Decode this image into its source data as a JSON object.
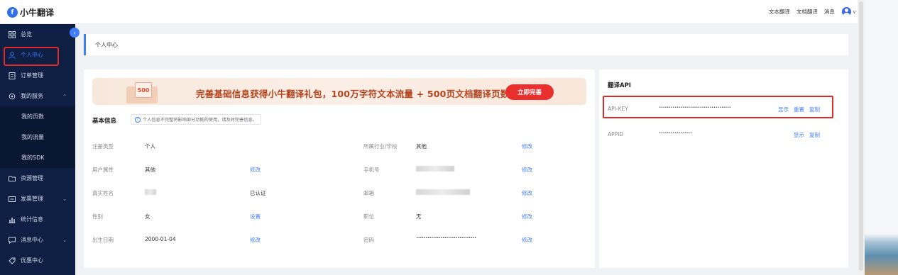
{
  "app": {
    "name": "小牛翻译",
    "logo_glyph": "f"
  },
  "topbar": {
    "links": [
      "文本翻译",
      "文档翻译",
      "消息"
    ],
    "dropdown_glyph": "∨"
  },
  "sidebar": {
    "items": [
      {
        "label": "总览",
        "icon": "grid-icon"
      },
      {
        "label": "个人中心",
        "icon": "user-icon",
        "active": true
      },
      {
        "label": "订单管理",
        "icon": "order-icon"
      },
      {
        "label": "我的服务",
        "icon": "service-icon",
        "expanded": true
      },
      {
        "label": "资源管理",
        "icon": "folder-icon"
      },
      {
        "label": "发票管理",
        "icon": "invoice-icon"
      },
      {
        "label": "统计信息",
        "icon": "stats-icon"
      },
      {
        "label": "消息中心",
        "icon": "message-icon"
      },
      {
        "label": "优惠中心",
        "icon": "tag-icon"
      }
    ],
    "sub_items": [
      "我的页数",
      "我的流量",
      "我的SDK"
    ],
    "collapse_glyph": "‹"
  },
  "breadcrumb": {
    "title": "个人中心"
  },
  "banner": {
    "coupon_text": "500",
    "text": "完善基础信息获得小牛翻译礼包，100万字符文本流量 + 500页文档翻译页数",
    "button": "立即完善"
  },
  "basic_info": {
    "title": "基本信息",
    "tip": "个人信息不完整将影响部分功能的使用，请及时完善信息。",
    "left_rows": [
      {
        "label": "注册类型",
        "value": "个人",
        "action": ""
      },
      {
        "label": "用户属性",
        "value": "其他",
        "action": "修改"
      },
      {
        "label": "真实姓名",
        "value": "",
        "action": "已认证"
      },
      {
        "label": "性别",
        "value": "女",
        "action": "设置"
      },
      {
        "label": "出生日期",
        "value": "2000-01-04",
        "action": "修改"
      }
    ],
    "right_rows": [
      {
        "label": "所属行业/学校",
        "value": "其他",
        "action": "修改"
      },
      {
        "label": "手机号",
        "value": "",
        "action": "修改"
      },
      {
        "label": "邮箱",
        "value": "",
        "action": "修改"
      },
      {
        "label": "职位",
        "value": "无",
        "action": "修改"
      },
      {
        "label": "密码",
        "value": "••••••••••••••••••••••••••••••••",
        "action": "修改"
      }
    ]
  },
  "api": {
    "title": "翻译API",
    "key_label": "API-KEY",
    "key_value": "•••••••••••••••••••••••••••••••••••••",
    "key_actions": [
      "显示",
      "重置",
      "复制"
    ],
    "appid_label": "APPID",
    "appid_value": "•••••••••••••••••",
    "appid_actions": [
      "显示",
      "复制"
    ]
  },
  "colors": {
    "accent": "#3f7dff",
    "sidebar": "#0f1f44",
    "highlight": "#e02a2a",
    "banner_button": "#ea2f2f"
  }
}
